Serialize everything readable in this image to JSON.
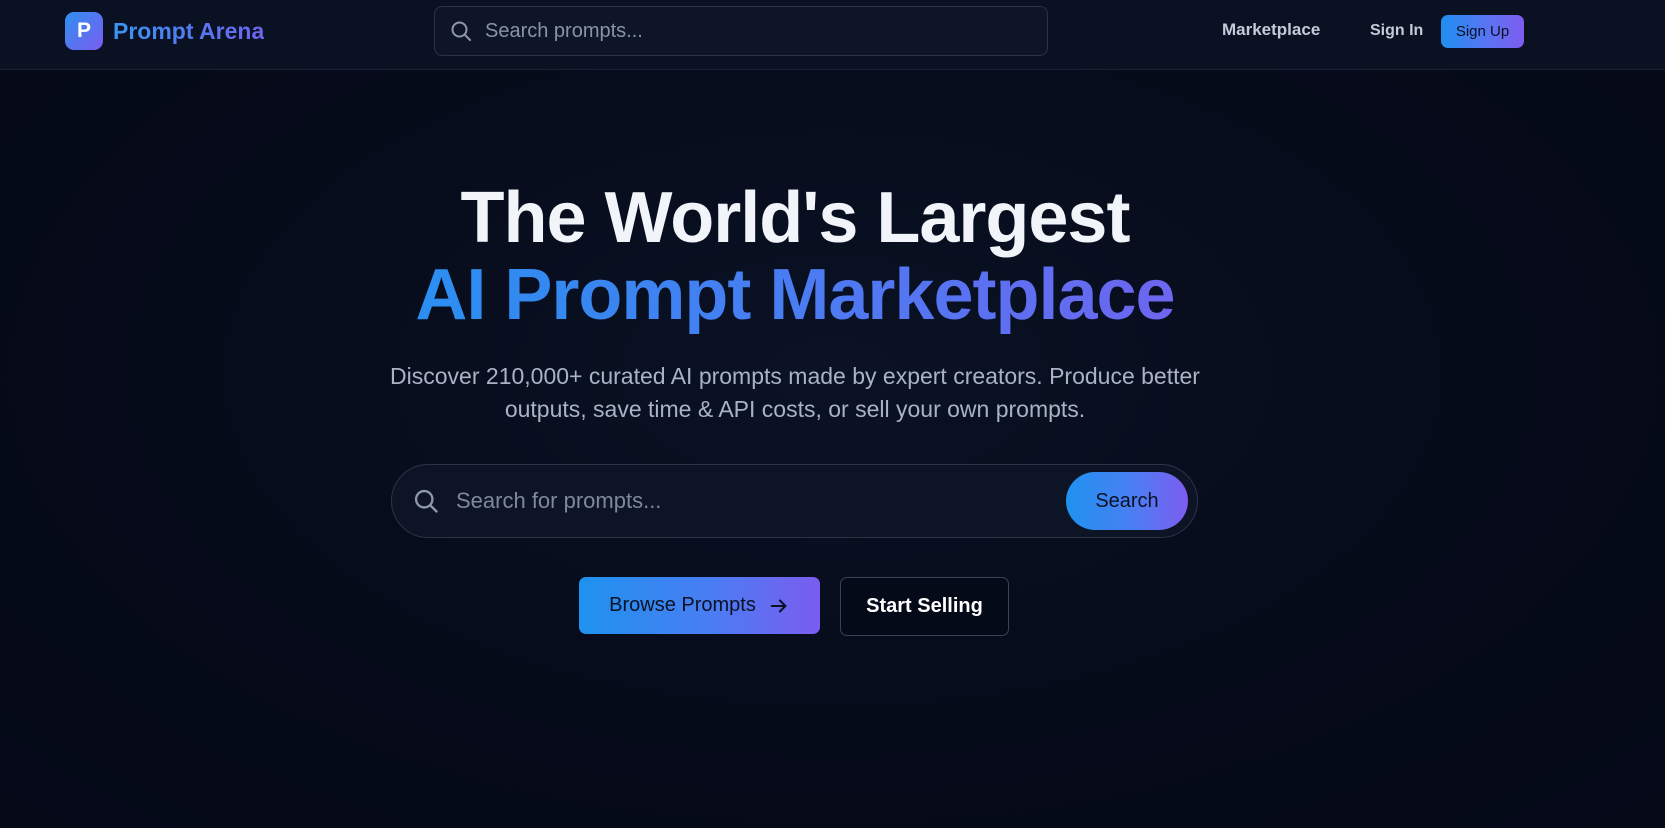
{
  "header": {
    "logo_letter": "P",
    "brand_name": "Prompt Arena",
    "search_placeholder": "Search prompts...",
    "nav": {
      "marketplace": "Marketplace",
      "sign_in": "Sign In",
      "sign_up": "Sign Up"
    }
  },
  "hero": {
    "title_line1": "The World's Largest",
    "title_line2": "AI Prompt Marketplace",
    "subtitle_line1": "Discover 210,000+ curated AI prompts made by expert creators. Produce better",
    "subtitle_line2": "outputs, save time & API costs, or sell your own prompts.",
    "search_placeholder": "Search for prompts...",
    "search_button": "Search",
    "browse_button": "Browse Prompts",
    "sell_button": "Start Selling"
  },
  "icons": {
    "header_search": "search-icon",
    "hero_search": "search-icon",
    "browse_arrow": "arrow-right-icon"
  },
  "colors": {
    "background": "#050a1a",
    "header_bg": "#0a1122",
    "accent_start": "#1f8ff0",
    "accent_end": "#7d5cf0",
    "title_text": "#f1f4f9",
    "subtitle_text": "#a9b3c6"
  }
}
